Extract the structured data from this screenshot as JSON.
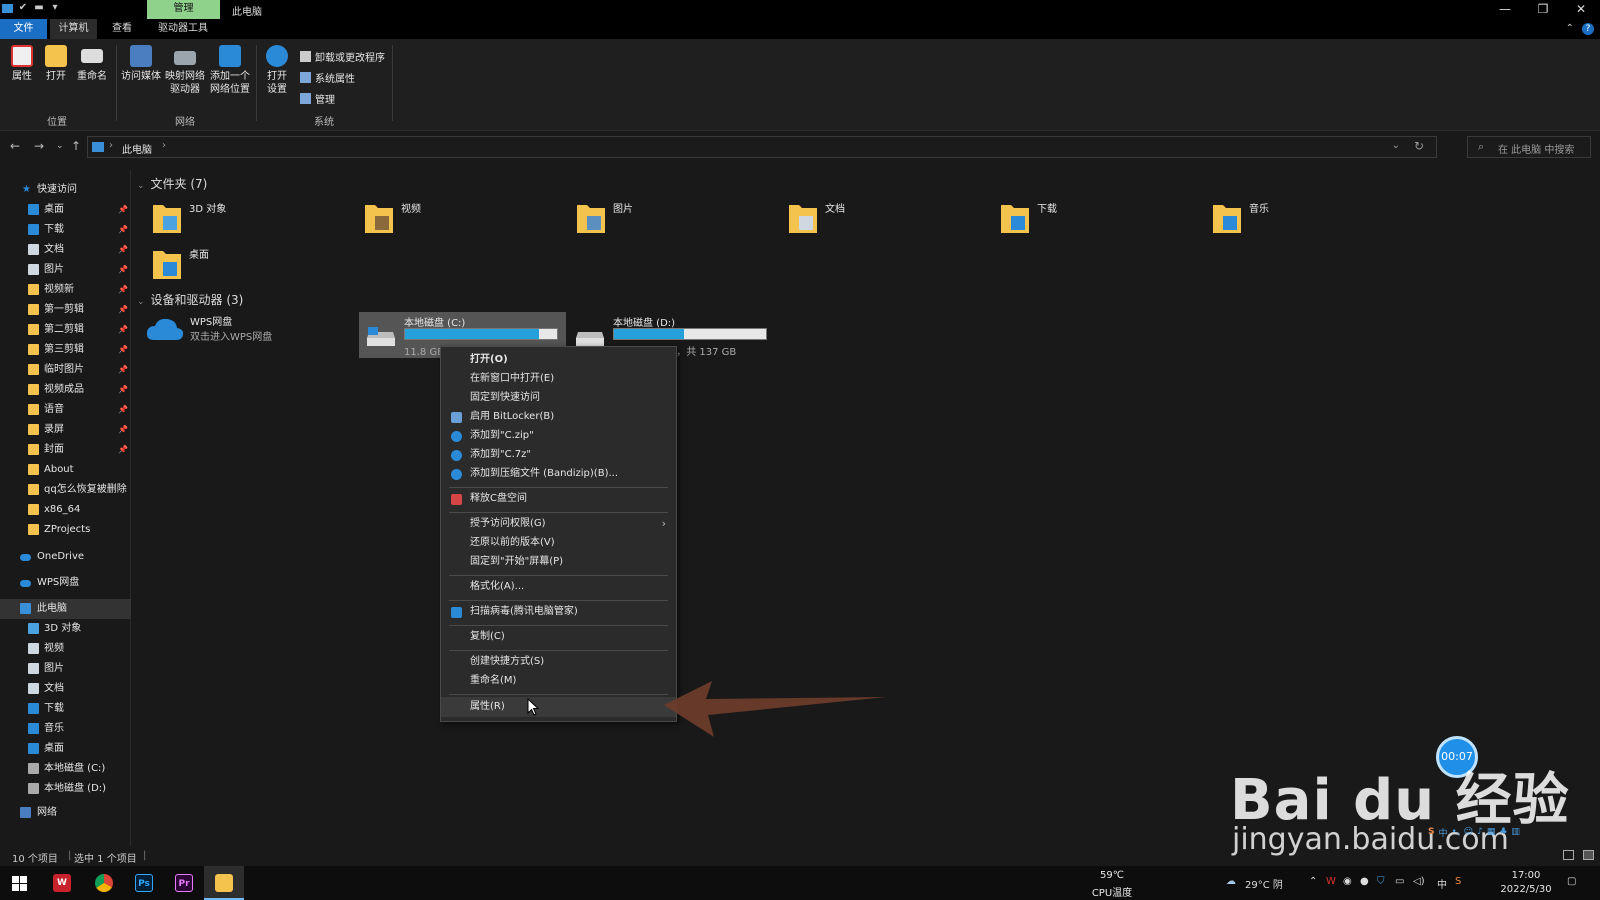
{
  "titlebar": {
    "context_tab": "管理",
    "title": "此电脑",
    "controls": [
      "—",
      "❐",
      "✕"
    ]
  },
  "ribbon_tabs": {
    "file": "文件",
    "computer": "计算机",
    "view": "查看",
    "drive_tools": "驱动器工具"
  },
  "ribbon": {
    "properties": "属性",
    "open": "打开",
    "rename": "重命名",
    "group_location": "位置",
    "access_media": "访问媒体",
    "map_network_1": "映射网络",
    "map_network_2": "驱动器",
    "add_location_1": "添加一个",
    "add_location_2": "网络位置",
    "group_network": "网络",
    "open_settings_1": "打开",
    "open_settings_2": "设置",
    "uninstall": "卸载或更改程序",
    "system_properties": "系统属性",
    "manage": "管理",
    "group_system": "系统"
  },
  "address": {
    "crumb": "此电脑",
    "search_placeholder": "在 此电脑 中搜索"
  },
  "sidebar": {
    "quick_access": "快速访问",
    "items": [
      {
        "label": "桌面",
        "color": "#2a8ad8"
      },
      {
        "label": "下载",
        "color": "#2a8ad8"
      },
      {
        "label": "文档",
        "color": "#cfd8e0"
      },
      {
        "label": "图片",
        "color": "#cfd8e0"
      },
      {
        "label": "视频新",
        "color": "#f4c34e"
      },
      {
        "label": "第一剪辑",
        "color": "#f4c34e"
      },
      {
        "label": "第二剪辑",
        "color": "#f4c34e"
      },
      {
        "label": "第三剪辑",
        "color": "#f4c34e"
      },
      {
        "label": "临时图片",
        "color": "#f4c34e"
      },
      {
        "label": "视频成品",
        "color": "#f4c34e"
      },
      {
        "label": "语音",
        "color": "#f4c34e"
      },
      {
        "label": "录屏",
        "color": "#f4c34e"
      },
      {
        "label": "封面",
        "color": "#f4c34e"
      },
      {
        "label": "About",
        "color": "#f4c34e"
      },
      {
        "label": "qq怎么恢复被删除",
        "color": "#f4c34e"
      },
      {
        "label": "x86_64",
        "color": "#f4c34e"
      },
      {
        "label": "ZProjects",
        "color": "#f4c34e"
      }
    ],
    "onedrive": "OneDrive",
    "wps": "WPS网盘",
    "this_pc": "此电脑",
    "pc_items": [
      {
        "label": "3D 对象",
        "color": "#4aa3e0"
      },
      {
        "label": "视频",
        "color": "#cfd8e0"
      },
      {
        "label": "图片",
        "color": "#cfd8e0"
      },
      {
        "label": "文档",
        "color": "#cfd8e0"
      },
      {
        "label": "下载",
        "color": "#2a8ad8"
      },
      {
        "label": "音乐",
        "color": "#2a8ad8"
      },
      {
        "label": "桌面",
        "color": "#2a8ad8"
      },
      {
        "label": "本地磁盘 (C:)",
        "color": "#aaaaaa"
      },
      {
        "label": "本地磁盘 (D:)",
        "color": "#aaaaaa"
      }
    ],
    "network": "网络"
  },
  "content": {
    "folders_header": "文件夹 (7)",
    "folders": [
      "3D 对象",
      "视频",
      "图片",
      "文档",
      "下载",
      "音乐",
      "桌面"
    ],
    "devices_header": "设备和驱动器 (3)",
    "wps_name": "WPS网盘",
    "wps_desc": "双击进入WPS网盘",
    "drive_c": {
      "name": "本地磁盘 (C:)",
      "info": "11.8 GB 可用，共 99.9 GB",
      "used_fraction": 0.88
    },
    "drive_d": {
      "name": "本地磁盘 (D:)",
      "info": "73.1 GB 可用，共 137 GB",
      "used_fraction": 0.46
    }
  },
  "context_menu": {
    "open": "打开(O)",
    "open_new_window": "在新窗口中打开(E)",
    "pin_quick": "固定到快速访问",
    "bitlocker": "启用 BitLocker(B)",
    "add_zip": "添加到\"C.zip\"",
    "add_7z": "添加到\"C.7z\"",
    "add_bandizip": "添加到压缩文件 (Bandizip)(B)...",
    "free_space": "释放C盘空间",
    "grant_access": "授予访问权限(G)",
    "restore_versions": "还原以前的版本(V)",
    "pin_start": "固定到\"开始\"屏幕(P)",
    "format": "格式化(A)...",
    "scan_virus": "扫描病毒(腾讯电脑管家)",
    "copy": "复制(C)",
    "create_shortcut": "创建快捷方式(S)",
    "rename": "重命名(M)",
    "properties": "属性(R)"
  },
  "statusbar": {
    "items": "10 个项目",
    "selected": "选中 1 个项目"
  },
  "taskbar": {
    "cpu_temp": "59℃",
    "cpu_label": "CPU温度",
    "weather": "29°C 阴",
    "ime": "中",
    "time": "17:00",
    "date": "2022/5/30"
  },
  "overlay": {
    "timer": "00:07",
    "watermark_brand": "Bai du 经验",
    "watermark_url": "jingyan.baidu.com"
  },
  "colors": {
    "accent_blue": "#1a6fc4",
    "manage_tab": "#8fd28b",
    "drive_bar": "#26a0da",
    "arrow": "#6a3b2a"
  }
}
